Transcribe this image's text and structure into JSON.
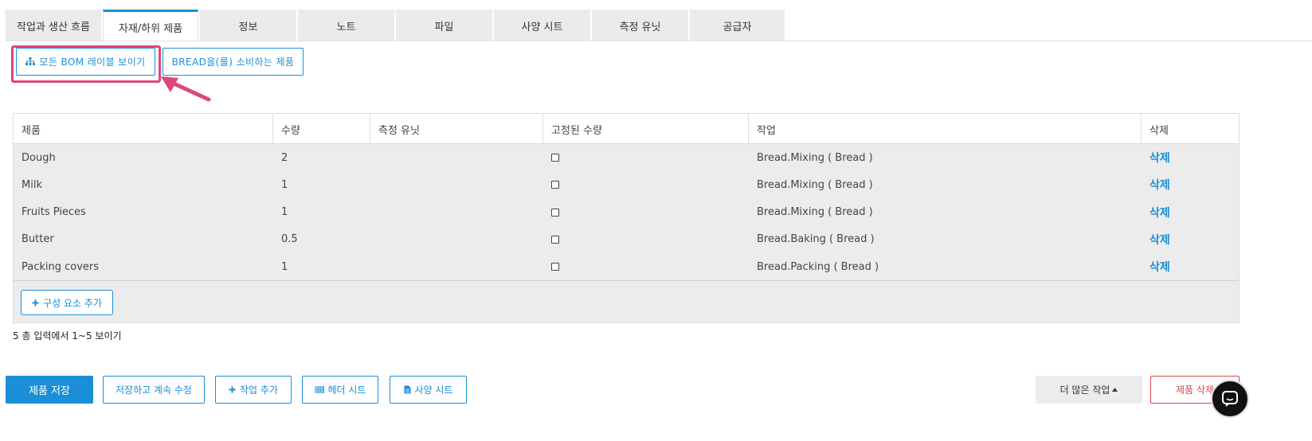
{
  "tabs": [
    {
      "label": "작업과 생산 흐름",
      "active": false
    },
    {
      "label": "자재/하위 제품",
      "active": true
    },
    {
      "label": "정보",
      "active": false
    },
    {
      "label": "노트",
      "active": false
    },
    {
      "label": "파일",
      "active": false
    },
    {
      "label": "사양 시트",
      "active": false
    },
    {
      "label": "측정 유닛",
      "active": false
    },
    {
      "label": "공급자",
      "active": false
    }
  ],
  "toolbar": {
    "show_bom_label": "모든 BOM 레이블 보이기",
    "consuming_products_label": "BREAD을(를) 소비하는 제품"
  },
  "table": {
    "columns": [
      "제품",
      "수량",
      "측정 유닛",
      "고정된 수량",
      "작업",
      "삭제"
    ],
    "rows": [
      {
        "product": "Dough",
        "qty": "2",
        "unit": "",
        "fixed": false,
        "operation": "Bread.Mixing ( Bread )",
        "delete": "삭제"
      },
      {
        "product": "Milk",
        "qty": "1",
        "unit": "",
        "fixed": false,
        "operation": "Bread.Mixing ( Bread )",
        "delete": "삭제"
      },
      {
        "product": "Fruits Pieces",
        "qty": "1",
        "unit": "",
        "fixed": false,
        "operation": "Bread.Mixing ( Bread )",
        "delete": "삭제"
      },
      {
        "product": "Butter",
        "qty": "0.5",
        "unit": "",
        "fixed": false,
        "operation": "Bread.Baking ( Bread )",
        "delete": "삭제"
      },
      {
        "product": "Packing covers",
        "qty": "1",
        "unit": "",
        "fixed": false,
        "operation": "Bread.Packing ( Bread )",
        "delete": "삭제"
      }
    ],
    "add_component_label": "구성 요소 추가"
  },
  "count_text": "5 총 입력에서 1~5 보이기",
  "footer": {
    "save_label": "제품 저장",
    "save_continue_label": "저장하고 계속 수정",
    "add_operation_label": "작업 추가",
    "header_sheet_label": "헤더 시트",
    "spec_sheet_label": "사양 시트",
    "more_actions_label": "더 많은 작업",
    "delete_product_label": "제품 삭제"
  },
  "colors": {
    "accent": "#1a8fd8",
    "highlight": "#e0467a",
    "danger": "#d9474b"
  },
  "icons": {
    "bom": "sitemap-icon",
    "add": "plus-icon",
    "header_sheet": "barcode-icon",
    "spec_sheet": "file-icon",
    "more": "caret-up-icon",
    "chat": "chat-icon",
    "annotation": "arrow-annotation"
  }
}
